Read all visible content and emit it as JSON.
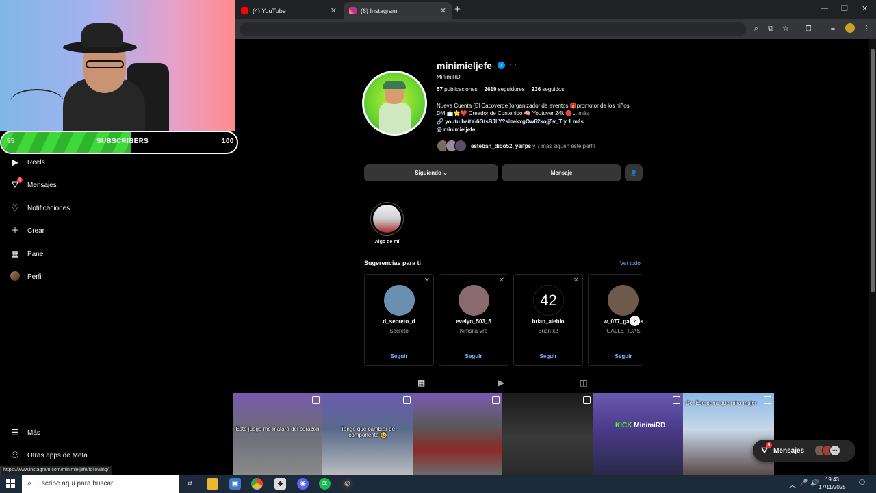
{
  "browser": {
    "tabs": [
      {
        "title": "(4) YouTube"
      },
      {
        "title": "(6) Instagram"
      }
    ],
    "colors": {
      "youtube": "#ff0000",
      "instagram": "#d62976"
    }
  },
  "overlay": {
    "subscribers": {
      "current": "55",
      "label": "SUBSCRIBERS",
      "goal": "100",
      "progress": 0.55,
      "bar_color": "#3fd93c"
    }
  },
  "nav": {
    "items": [
      {
        "label": "Reels",
        "icon": "reels-icon"
      },
      {
        "label": "Mensajes",
        "icon": "messenger-icon",
        "badge": "6"
      },
      {
        "label": "Notificaciones",
        "icon": "heart-icon"
      },
      {
        "label": "Crear",
        "icon": "plus-icon"
      },
      {
        "label": "Panel",
        "icon": "dashboard-icon"
      },
      {
        "label": "Perfil",
        "icon": "avatar"
      }
    ],
    "more": "Más",
    "meta": "Otras apps de Meta"
  },
  "profile": {
    "username": "minimieljefe",
    "full_name": "MinimiRD",
    "stats": [
      {
        "value": "57",
        "label": "publicaciones"
      },
      {
        "value": "2619",
        "label": "seguidores"
      },
      {
        "value": "236",
        "label": "seguidos"
      }
    ],
    "bio_line1": "Nueva Cuenta (El Cacoverde )organizador de eventos 🎁promotor de los niños",
    "bio_line2": "DM 📩🌟❤️ Creador de Contenido 🧠 Youtuver 24k 🔴...",
    "bio_more": "más",
    "link": "youtu.be/tY-6GtsBJLY?si=ekxgOw62kojj5v_T y 1 más",
    "threads": "minimieljefe",
    "followed_by_names": "esteban_dido52, yeifps",
    "followed_by_rest": "y 7 más siguen este perfil",
    "buttons": {
      "following": "Siguiendo",
      "message": "Mensaje"
    }
  },
  "highlight": {
    "label": "Algo de mí"
  },
  "suggestions": {
    "title": "Sugerencias para ti",
    "see_all": "Ver todo",
    "follow_label": "Seguir",
    "cards": [
      {
        "username": "d_secreto_d",
        "name": "Secreto",
        "color": "#6a8fb0"
      },
      {
        "username": "evelyn_503_5",
        "name": "Kimsita Vro",
        "color": "#8a6a6e"
      },
      {
        "username": "brian_aleblo",
        "name": "Brian x2",
        "color": "#000000"
      },
      {
        "username": "w_077_galletas",
        "name": "GALLETICAS",
        "color": "#6e5a4a"
      }
    ]
  },
  "clips": [
    {
      "caption": "Este juego me matara del corazon",
      "kick": false
    },
    {
      "caption": "Tengo que cambiar de componente 😂",
      "kick": false
    },
    {
      "caption": "",
      "kick": false
    },
    {
      "caption": "",
      "kick": false
    },
    {
      "caption": "",
      "kick": true,
      "kick_a": "KICK",
      "kick_b": "MinimiRD"
    },
    {
      "caption": "Cc. Ese pana que mira mujer",
      "kick": false
    }
  ],
  "messages_pill": {
    "label": "Mensajes",
    "badge": "6"
  },
  "status_url": "https://www.instagram.com/minimieljefe/following/",
  "taskbar": {
    "search_placeholder": "Escribe aquí para buscar.",
    "time": "19:43",
    "date": "17/11/2025"
  }
}
